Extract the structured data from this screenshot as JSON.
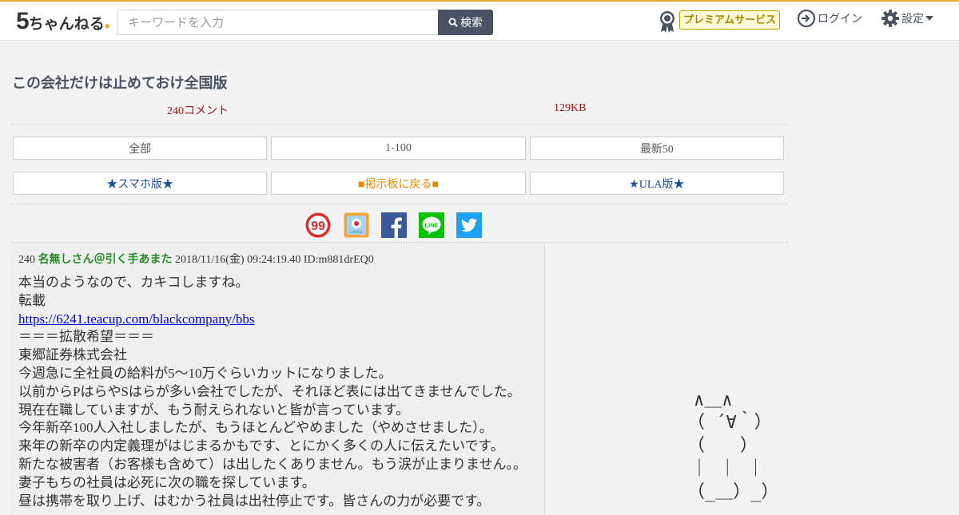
{
  "header": {
    "logo_five": "5",
    "logo_name": "ちゃんねる",
    "search_placeholder": "キーワードを入力",
    "search_button": "検索",
    "premium_label": "プレミアムサービス",
    "login_label": "ログイン",
    "settings_label": "設定"
  },
  "thread": {
    "title": "この会社だけは止めておけ全国版",
    "comment_count": "240コメント",
    "size": "129KB"
  },
  "nav": {
    "all": "全部",
    "range": "1-100",
    "latest": "最新50",
    "smartphone": "★スマホ版★",
    "back_to_board": "■掲示板に戻る■",
    "ula": "★ULA版★"
  },
  "share_icons": [
    "5ch-99-icon",
    "bookmark-icon",
    "facebook-icon",
    "line-icon",
    "twitter-icon"
  ],
  "post": {
    "number": "240",
    "name": "名無しさん＠引く手あまた",
    "datetime": "2018/11/16(金) 09:24:19.40",
    "id": "ID:m881drEQ0",
    "lines": [
      "本当のようなので、カキコしますね。",
      "転載",
      "https://6241.teacup.com/blackcompany/bbs",
      "＝＝＝拡散希望＝＝＝",
      "東郷証券株式会社",
      "今週急に全社員の給料が5～10万ぐらいカットになりました。",
      "以前からPはらやSはらが多い会社でしたが、それほど表には出てきませんでした。",
      "現在在職していますが、もう耐えられないと皆が言っています。",
      "今年新卒100人入社しましたが、もうほとんどやめました（やめさせました）。",
      "来年の新卒の内定義理がはじまるかもです、とにかく多くの人に伝えたいです。",
      "新たな被害者（お客様も含めて）は出したくありません。もう涙が止まりません。。",
      "妻子もちの社員は必死に次の職を探しています。",
      "昼は携帯を取り上げ、はむかう社員は出社停止です。皆さんの力が必要です。"
    ]
  },
  "ascii_art": {
    "line1": "∧＿∧",
    "line2": "（ ´∀｀）",
    "line3": "（　　）",
    "line4": "｜ ｜ ｜",
    "line5": "（_＿）_）"
  },
  "colors": {
    "accent_top": "#f0a732",
    "search_button_bg": "#4a5363",
    "count_red": "#a31515",
    "poster_green": "#228b22",
    "link_blue": "#0000ee",
    "smartphone_blue": "#1a4fa0",
    "board_orange": "#e68a00"
  }
}
